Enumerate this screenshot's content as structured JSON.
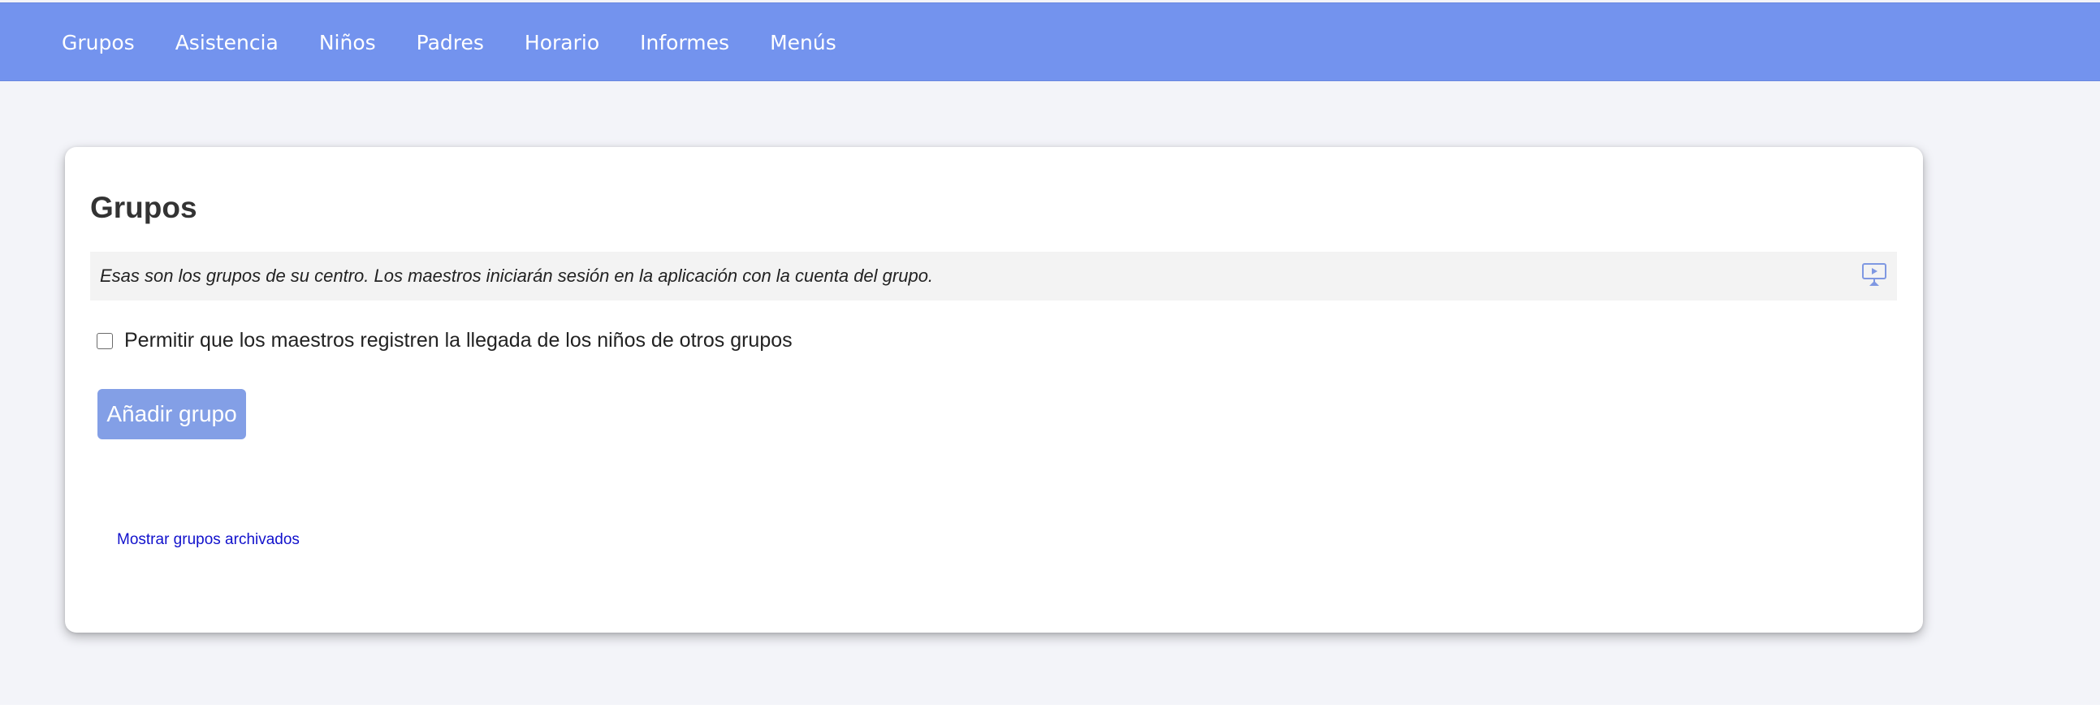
{
  "nav": {
    "items": [
      {
        "label": "Grupos"
      },
      {
        "label": "Asistencia"
      },
      {
        "label": "Niños"
      },
      {
        "label": "Padres"
      },
      {
        "label": "Horario"
      },
      {
        "label": "Informes"
      },
      {
        "label": "Menús"
      }
    ]
  },
  "main": {
    "title": "Grupos",
    "info_text": "Esas son los grupos de su centro. Los maestros iniciarán sesión en la aplicación con la cuenta del grupo.",
    "info_icon": "video-presentation-icon",
    "checkbox": {
      "label": "Permitir que los maestros registren la llegada de los niños de otros grupos",
      "checked": false
    },
    "add_button_label": "Añadir grupo",
    "archive_link_label": "Mostrar grupos archivados"
  },
  "colors": {
    "topbar": "#7393ee",
    "accent_button": "#839fe6",
    "link": "#1111cc",
    "page_background": "#f3f4f9"
  }
}
